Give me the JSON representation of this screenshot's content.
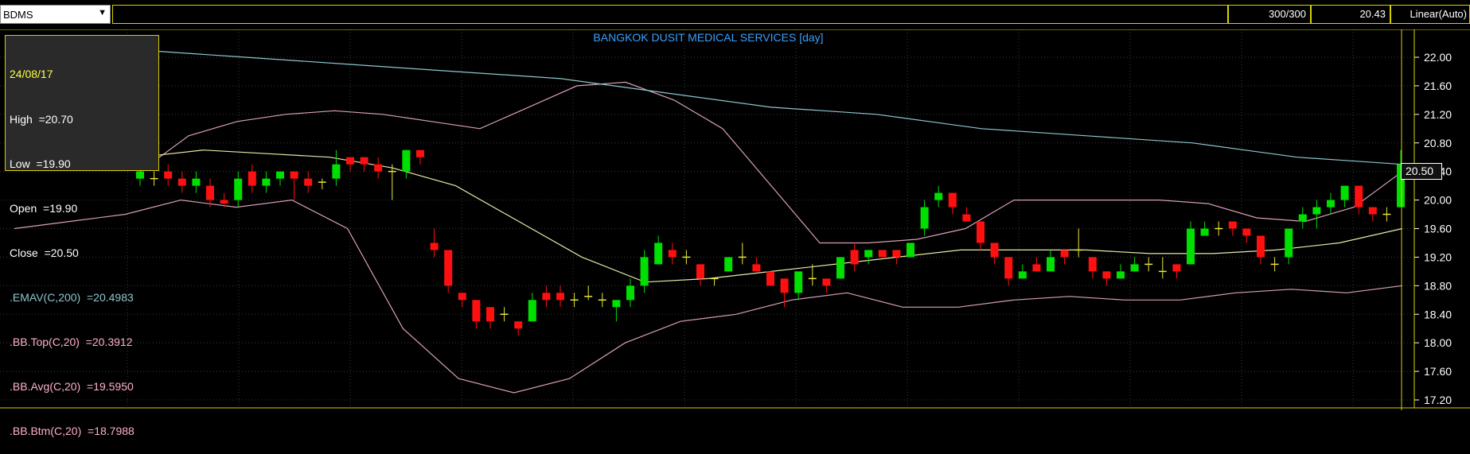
{
  "toolbar": {
    "symbol": "BDMS",
    "bars": "300/300",
    "last": "20.43",
    "scale": "Linear(Auto)"
  },
  "info": {
    "date": "24/08/17",
    "high": "High  =20.70",
    "low": "Low  =19.90",
    "open": "Open  =19.90",
    "close": "Close  =20.50",
    "emav": ".EMAV(C,200)  =20.4983",
    "bbtop": ".BB.Top(C,20)  =20.3912",
    "bbavg": ".BB.Avg(C,20)  =19.5950",
    "bbbtm": ".BB.Btm(C,20)  =18.7988"
  },
  "colors": {
    "background": "#000000",
    "frame": "#d8d000",
    "grid": "#3a3a3a",
    "up": "#00e000",
    "down": "#ff1010",
    "doji": "#e8e838",
    "emav": "#8ec6cc",
    "bb_band": "#d8a0b8",
    "bb_avg": "#e8e8a8",
    "title": "#3aa0ff",
    "info_date": "#ffff40",
    "info_text": "#ffffff",
    "info_emav": "#8ec6cc",
    "info_bb": "#ffb0c8"
  },
  "chart_data": {
    "type": "candlestick",
    "title": "BANGKOK DUSIT MEDICAL SERVICES [day]",
    "ylim": [
      17.0,
      22.3
    ],
    "y_ticks": [
      "22.00",
      "21.60",
      "21.20",
      "20.80",
      "20.40",
      "20.00",
      "19.60",
      "19.20",
      "18.80",
      "18.40",
      "18.00",
      "17.60",
      "17.20"
    ],
    "last_price_label": "20.50",
    "grid": true,
    "candles": [
      {
        "open": 20.3,
        "close": 20.4,
        "high": 20.5,
        "low": 20.2
      },
      {
        "open": 20.3,
        "close": 20.3,
        "high": 20.4,
        "low": 20.2
      },
      {
        "open": 20.4,
        "close": 20.3,
        "high": 20.5,
        "low": 20.2
      },
      {
        "open": 20.3,
        "close": 20.2,
        "high": 20.4,
        "low": 20.1
      },
      {
        "open": 20.2,
        "close": 20.3,
        "high": 20.4,
        "low": 20.1
      },
      {
        "open": 20.2,
        "close": 20.0,
        "high": 20.3,
        "low": 19.9
      },
      {
        "open": 20.0,
        "close": 19.95,
        "high": 20.1,
        "low": 19.9
      },
      {
        "open": 20.0,
        "close": 20.3,
        "high": 20.4,
        "low": 19.9
      },
      {
        "open": 20.4,
        "close": 20.2,
        "high": 20.5,
        "low": 20.1
      },
      {
        "open": 20.2,
        "close": 20.3,
        "high": 20.4,
        "low": 20.1
      },
      {
        "open": 20.3,
        "close": 20.4,
        "high": 20.4,
        "low": 20.2
      },
      {
        "open": 20.4,
        "close": 20.3,
        "high": 20.4,
        "low": 20.0
      },
      {
        "open": 20.3,
        "close": 20.2,
        "high": 20.4,
        "low": 20.1
      },
      {
        "open": 20.25,
        "close": 20.25,
        "high": 20.3,
        "low": 20.15
      },
      {
        "open": 20.3,
        "close": 20.5,
        "high": 20.7,
        "low": 20.2
      },
      {
        "open": 20.6,
        "close": 20.5,
        "high": 20.6,
        "low": 20.4
      },
      {
        "open": 20.6,
        "close": 20.5,
        "high": 20.6,
        "low": 20.4
      },
      {
        "open": 20.5,
        "close": 20.4,
        "high": 20.6,
        "low": 20.3
      },
      {
        "open": 20.4,
        "close": 20.4,
        "high": 20.5,
        "low": 20.0
      },
      {
        "open": 20.4,
        "close": 20.7,
        "high": 20.7,
        "low": 20.3
      },
      {
        "open": 20.7,
        "close": 20.6,
        "high": 20.7,
        "low": 20.5
      },
      {
        "open": 19.4,
        "close": 19.3,
        "high": 19.6,
        "low": 19.2
      },
      {
        "open": 19.3,
        "close": 18.8,
        "high": 19.3,
        "low": 18.7
      },
      {
        "open": 18.7,
        "close": 18.6,
        "high": 18.7,
        "low": 18.5
      },
      {
        "open": 18.6,
        "close": 18.3,
        "high": 18.6,
        "low": 18.2
      },
      {
        "open": 18.5,
        "close": 18.3,
        "high": 18.5,
        "low": 18.2
      },
      {
        "open": 18.4,
        "close": 18.4,
        "high": 18.5,
        "low": 18.3
      },
      {
        "open": 18.3,
        "close": 18.2,
        "high": 18.3,
        "low": 18.1
      },
      {
        "open": 18.3,
        "close": 18.6,
        "high": 18.7,
        "low": 18.3
      },
      {
        "open": 18.7,
        "close": 18.6,
        "high": 18.8,
        "low": 18.5
      },
      {
        "open": 18.7,
        "close": 18.6,
        "high": 18.8,
        "low": 18.5
      },
      {
        "open": 18.6,
        "close": 18.6,
        "high": 18.7,
        "low": 18.5
      },
      {
        "open": 18.65,
        "close": 18.65,
        "high": 18.8,
        "low": 18.6
      },
      {
        "open": 18.6,
        "close": 18.6,
        "high": 18.7,
        "low": 18.5
      },
      {
        "open": 18.5,
        "close": 18.6,
        "high": 18.6,
        "low": 18.3
      },
      {
        "open": 18.6,
        "close": 18.8,
        "high": 18.9,
        "low": 18.5
      },
      {
        "open": 18.8,
        "close": 19.2,
        "high": 19.3,
        "low": 18.7
      },
      {
        "open": 19.1,
        "close": 19.4,
        "high": 19.5,
        "low": 19.1
      },
      {
        "open": 19.3,
        "close": 19.2,
        "high": 19.4,
        "low": 19.1
      },
      {
        "open": 19.2,
        "close": 19.2,
        "high": 19.3,
        "low": 19.1
      },
      {
        "open": 19.1,
        "close": 18.9,
        "high": 19.1,
        "low": 18.8
      },
      {
        "open": 18.9,
        "close": 18.9,
        "high": 18.9,
        "low": 18.8
      },
      {
        "open": 19.0,
        "close": 19.2,
        "high": 19.2,
        "low": 19.0
      },
      {
        "open": 19.2,
        "close": 19.2,
        "high": 19.4,
        "low": 19.1
      },
      {
        "open": 19.1,
        "close": 19.0,
        "high": 19.2,
        "low": 19.0
      },
      {
        "open": 19.0,
        "close": 18.8,
        "high": 19.0,
        "low": 18.8
      },
      {
        "open": 18.9,
        "close": 18.7,
        "high": 18.9,
        "low": 18.5
      },
      {
        "open": 18.7,
        "close": 19.0,
        "high": 19.0,
        "low": 18.6
      },
      {
        "open": 18.9,
        "close": 18.9,
        "high": 19.1,
        "low": 18.8
      },
      {
        "open": 18.9,
        "close": 18.8,
        "high": 18.9,
        "low": 18.7
      },
      {
        "open": 18.9,
        "close": 19.2,
        "high": 19.2,
        "low": 18.9
      },
      {
        "open": 19.3,
        "close": 19.1,
        "high": 19.4,
        "low": 19.0
      },
      {
        "open": 19.2,
        "close": 19.3,
        "high": 19.3,
        "low": 19.1
      },
      {
        "open": 19.3,
        "close": 19.2,
        "high": 19.3,
        "low": 19.2
      },
      {
        "open": 19.3,
        "close": 19.2,
        "high": 19.3,
        "low": 19.1
      },
      {
        "open": 19.2,
        "close": 19.4,
        "high": 19.4,
        "low": 19.2
      },
      {
        "open": 19.6,
        "close": 19.9,
        "high": 20.0,
        "low": 19.5
      },
      {
        "open": 20.0,
        "close": 20.1,
        "high": 20.2,
        "low": 19.9
      },
      {
        "open": 20.1,
        "close": 19.9,
        "high": 20.1,
        "low": 19.8
      },
      {
        "open": 19.8,
        "close": 19.7,
        "high": 19.9,
        "low": 19.7
      },
      {
        "open": 19.7,
        "close": 19.4,
        "high": 19.7,
        "low": 19.3
      },
      {
        "open": 19.4,
        "close": 19.2,
        "high": 19.4,
        "low": 19.1
      },
      {
        "open": 19.2,
        "close": 18.9,
        "high": 19.2,
        "low": 18.8
      },
      {
        "open": 18.9,
        "close": 19.0,
        "high": 19.1,
        "low": 18.9
      },
      {
        "open": 19.1,
        "close": 19.0,
        "high": 19.2,
        "low": 19.0
      },
      {
        "open": 19.0,
        "close": 19.2,
        "high": 19.3,
        "low": 19.0
      },
      {
        "open": 19.3,
        "close": 19.2,
        "high": 19.3,
        "low": 19.1
      },
      {
        "open": 19.3,
        "close": 19.3,
        "high": 19.6,
        "low": 19.2
      },
      {
        "open": 19.2,
        "close": 19.0,
        "high": 19.2,
        "low": 18.9
      },
      {
        "open": 19.0,
        "close": 18.9,
        "high": 19.0,
        "low": 18.8
      },
      {
        "open": 18.9,
        "close": 19.0,
        "high": 19.1,
        "low": 18.9
      },
      {
        "open": 19.0,
        "close": 19.1,
        "high": 19.2,
        "low": 19.0
      },
      {
        "open": 19.1,
        "close": 19.1,
        "high": 19.2,
        "low": 19.0
      },
      {
        "open": 19.0,
        "close": 19.0,
        "high": 19.2,
        "low": 18.9
      },
      {
        "open": 19.1,
        "close": 19.0,
        "high": 19.1,
        "low": 18.9
      },
      {
        "open": 19.1,
        "close": 19.6,
        "high": 19.7,
        "low": 19.1
      },
      {
        "open": 19.5,
        "close": 19.6,
        "high": 19.7,
        "low": 19.5
      },
      {
        "open": 19.6,
        "close": 19.6,
        "high": 19.7,
        "low": 19.5
      },
      {
        "open": 19.7,
        "close": 19.6,
        "high": 19.7,
        "low": 19.5
      },
      {
        "open": 19.6,
        "close": 19.5,
        "high": 19.6,
        "low": 19.4
      },
      {
        "open": 19.5,
        "close": 19.2,
        "high": 19.5,
        "low": 19.1
      },
      {
        "open": 19.1,
        "close": 19.1,
        "high": 19.2,
        "low": 19.0
      },
      {
        "open": 19.2,
        "close": 19.6,
        "high": 19.6,
        "low": 19.1
      },
      {
        "open": 19.7,
        "close": 19.8,
        "high": 19.9,
        "low": 19.6
      },
      {
        "open": 19.8,
        "close": 19.9,
        "high": 20.0,
        "low": 19.6
      },
      {
        "open": 19.9,
        "close": 20.0,
        "high": 20.1,
        "low": 19.8
      },
      {
        "open": 20.0,
        "close": 20.2,
        "high": 20.2,
        "low": 19.9
      },
      {
        "open": 20.2,
        "close": 19.9,
        "high": 20.2,
        "low": 19.8
      },
      {
        "open": 19.9,
        "close": 19.8,
        "high": 19.9,
        "low": 19.7
      },
      {
        "open": 19.8,
        "close": 19.8,
        "high": 19.9,
        "low": 19.7
      },
      {
        "open": 19.9,
        "close": 20.5,
        "high": 20.7,
        "low": 19.9
      }
    ],
    "indicators": {
      "emav_200": [
        22.1,
        22.05,
        22.0,
        21.95,
        21.9,
        21.85,
        21.8,
        21.75,
        21.7,
        21.6,
        21.5,
        21.4,
        21.3,
        21.25,
        21.2,
        21.1,
        21.0,
        20.95,
        20.9,
        20.85,
        20.8,
        20.7,
        20.6,
        20.55,
        20.5
      ],
      "bb_top_20": [
        20.4,
        20.9,
        21.1,
        21.2,
        21.25,
        21.2,
        21.1,
        21.0,
        21.3,
        21.6,
        21.65,
        21.4,
        21.0,
        20.2,
        19.4,
        19.4,
        19.45,
        19.6,
        20.0,
        20.0,
        20.0,
        20.0,
        19.95,
        19.75,
        19.7,
        19.9,
        20.4
      ],
      "bb_avg_20": [
        20.6,
        20.7,
        20.65,
        20.6,
        20.45,
        20.2,
        19.7,
        19.2,
        18.85,
        18.9,
        19.0,
        19.1,
        19.2,
        19.3,
        19.3,
        19.3,
        19.25,
        19.25,
        19.3,
        19.4,
        19.6
      ],
      "bb_btm_20": [
        19.6,
        19.7,
        19.8,
        20.0,
        19.9,
        20.0,
        19.6,
        18.2,
        17.5,
        17.3,
        17.5,
        18.0,
        18.3,
        18.4,
        18.6,
        18.7,
        18.5,
        18.5,
        18.6,
        18.65,
        18.6,
        18.6,
        18.7,
        18.75,
        18.7,
        18.8
      ]
    }
  }
}
